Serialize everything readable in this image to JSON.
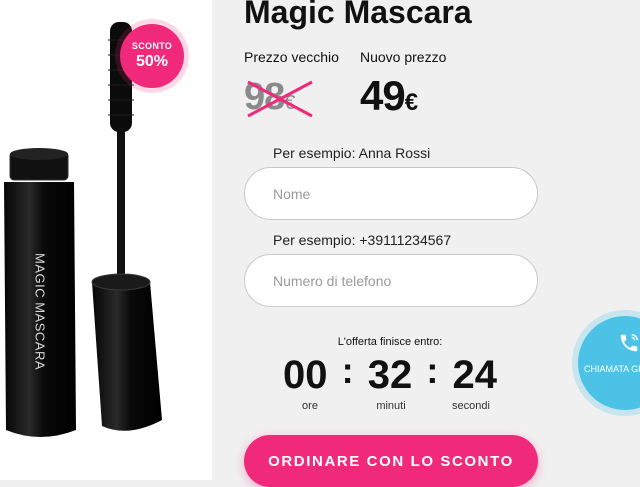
{
  "product": {
    "title": "Magic Mascara",
    "tube_text": "MAGIC MASCARA",
    "badge": {
      "line1": "SCONTO",
      "line2": "50%"
    }
  },
  "prices": {
    "old_label": "Prezzo vecchio",
    "new_label": "Nuovo prezzo",
    "old_value": "98",
    "new_value": "49",
    "currency": "€"
  },
  "form": {
    "name_hint": "Per esempio: Anna Rossi",
    "name_placeholder": "Nome",
    "phone_hint": "Per esempio: +39111234567",
    "phone_placeholder": "Numero di telefono"
  },
  "countdown": {
    "label": "L'offerta finisce entro:",
    "hours": "00",
    "minutes": "32",
    "seconds": "24",
    "hours_label": "ore",
    "minutes_label": "minuti",
    "seconds_label": "secondi"
  },
  "buttons": {
    "order": "ORDINARE CON LO SCONTO",
    "call": "CHIAMATA GR"
  },
  "colors": {
    "accent": "#f0297a",
    "call": "#4cc3e6",
    "background": "#f0f0f0"
  }
}
